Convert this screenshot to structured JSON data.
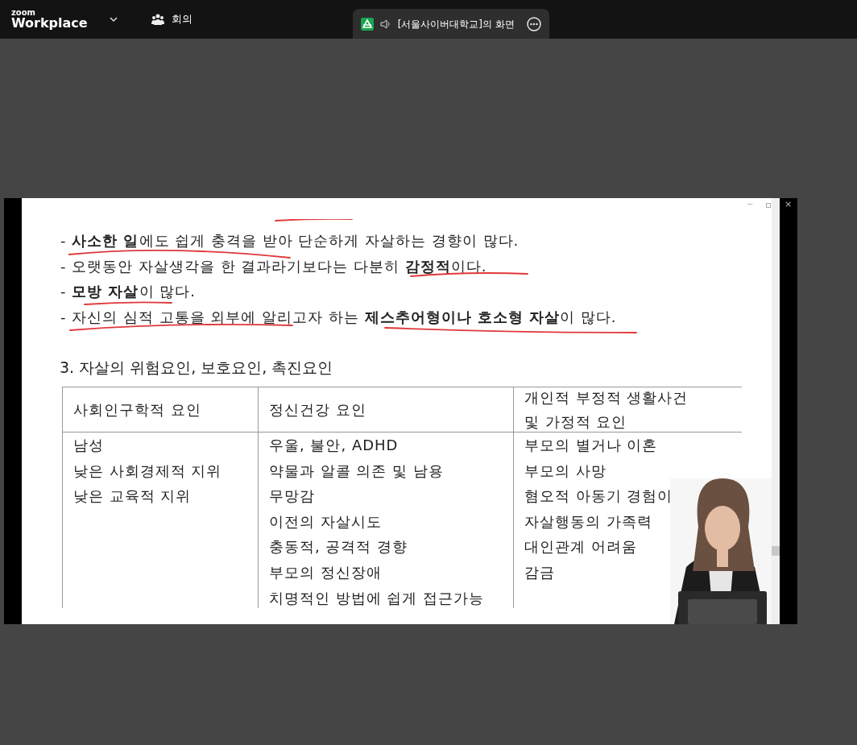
{
  "app_bar": {
    "logo_top": "zoom",
    "logo_bottom": "Workplace",
    "meeting_label": "회의",
    "share_tab": {
      "title": "[서울사이버대학교]의 화면"
    }
  },
  "shared_screen": {
    "window_controls": [
      "−",
      "×"
    ],
    "bullets": [
      {
        "text": "- **사소한 일**에도 쉽게 충격을 받아 단순하게 자살하는 경향이 많다."
      },
      {
        "text": "- 오랫동안 자살생각을 한 결과라기보다는 다분히 **감정적**이다."
      },
      {
        "text": "- **모방 자살**이 많다."
      },
      {
        "text": "- 자신의 심적 고통을 외부에 알리고자 하는 **제스추어형이나 호소형 자살**이 많다."
      }
    ],
    "heading": "3. 자살의 위험요인, 보호요인, 촉진요인",
    "table": {
      "columns": [
        {
          "header": [
            "사회인구학적 요인"
          ],
          "items": [
            "남성",
            "낮은 사회경제적 지위",
            "낮은 교육적 지위"
          ]
        },
        {
          "header": [
            "정신건강 요인"
          ],
          "items": [
            "우울, 불안, ADHD",
            "약물과 알콜 의존 및 남용",
            "무망감",
            "이전의 자살시도",
            "충동적, 공격적 경향",
            "부모의 정신장애",
            "치명적인 방법에 쉽게 접근가능"
          ]
        },
        {
          "header": [
            "개인적 부정적 생활사건",
            "및 가정적 요인"
          ],
          "items": [
            "부모의 별거나 이혼",
            "부모의 사망",
            "혐오적 아동기 경험이",
            "자살행동의 가족력",
            "대인관계 어려움",
            "감금"
          ]
        }
      ]
    },
    "presenter_video": {
      "kind": "picture"
    }
  }
}
